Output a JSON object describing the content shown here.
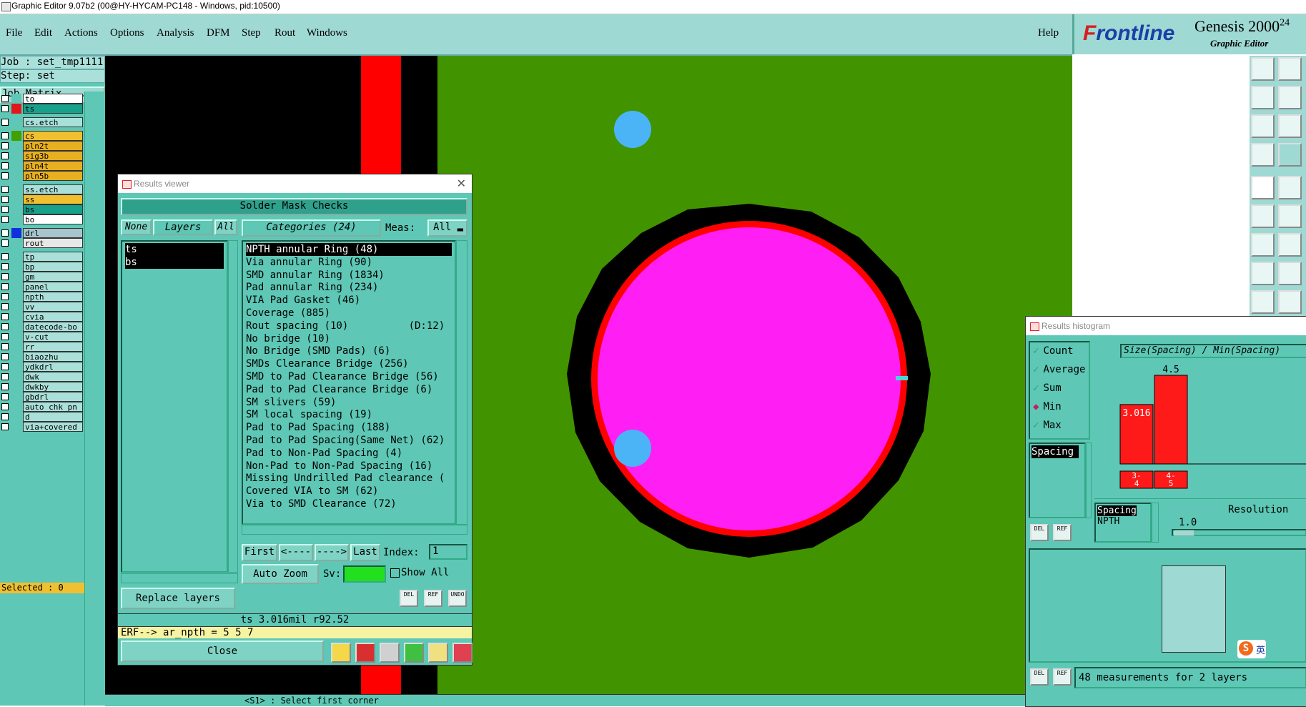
{
  "window": {
    "title": "Graphic Editor 9.07b2 (00@HY-HYCAM-PC148 - Windows, pid:10500)"
  },
  "menu": [
    "File",
    "Edit",
    "Actions",
    "Options",
    "Analysis",
    "DFM",
    "Step",
    "Rout",
    "Windows"
  ],
  "help_label": "Help",
  "logo": {
    "brand_f": "F",
    "brand_rest": "rontline",
    "product": "Genesis 2000",
    "version_fragment": "24",
    "subtitle": "Graphic Editor"
  },
  "job_panel": {
    "job": "Job : set_tmp1111",
    "step": "Step: set",
    "job_matrix_button": "Job Matrix ...",
    "selected": "Selected : 0"
  },
  "layers": [
    {
      "name": "to",
      "color": "#ffffff",
      "swatch": "#5ec7b5"
    },
    {
      "name": "ts",
      "color": "#17a08a",
      "swatch": "#e01818",
      "checked": true,
      "board": true
    },
    {
      "name": "cs.etch",
      "color": "#a9e0d9",
      "swatch": "#5ec7b5"
    },
    {
      "name": "cs",
      "color": "#f0c030",
      "swatch": "#41a000"
    },
    {
      "name": "pln2t",
      "color": "#e8b020",
      "swatch": "#5ec7b5"
    },
    {
      "name": "sig3b",
      "color": "#e8b020",
      "swatch": "#5ec7b5"
    },
    {
      "name": "pln4t",
      "color": "#e8b020",
      "swatch": "#5ec7b5"
    },
    {
      "name": "pln5b",
      "color": "#e8b020",
      "swatch": "#5ec7b5"
    },
    {
      "name": "ss.etch",
      "color": "#a9e0d9",
      "swatch": "#5ec7b5"
    },
    {
      "name": "ss",
      "color": "#f0c030",
      "swatch": "#5ec7b5"
    },
    {
      "name": "bs",
      "color": "#17a08a",
      "swatch": "#5ec7b5"
    },
    {
      "name": "bo",
      "color": "#ffffff",
      "swatch": "#5ec7b5"
    },
    {
      "name": "drl",
      "color": "#a8c4cc",
      "swatch": "#1030e0"
    },
    {
      "name": "rout",
      "color": "#e8e8e8",
      "swatch": "#5ec7b5"
    },
    {
      "name": "tp",
      "color": "#a9e0d9",
      "swatch": "#5ec7b5"
    },
    {
      "name": "bp",
      "color": "#a9e0d9",
      "swatch": "#5ec7b5"
    },
    {
      "name": "gm",
      "color": "#a9e0d9",
      "swatch": "#5ec7b5"
    },
    {
      "name": "panel",
      "color": "#a9e0d9",
      "swatch": "#5ec7b5"
    },
    {
      "name": "npth",
      "color": "#a9e0d9",
      "swatch": "#5ec7b5"
    },
    {
      "name": "vv",
      "color": "#a9e0d9",
      "swatch": "#5ec7b5"
    },
    {
      "name": "cvia",
      "color": "#a9e0d9",
      "swatch": "#5ec7b5"
    },
    {
      "name": "datecode-bo",
      "color": "#a9e0d9",
      "swatch": "#5ec7b5"
    },
    {
      "name": "v-cut",
      "color": "#a9e0d9",
      "swatch": "#5ec7b5"
    },
    {
      "name": "rr",
      "color": "#a9e0d9",
      "swatch": "#5ec7b5"
    },
    {
      "name": "biaozhu",
      "color": "#a9e0d9",
      "swatch": "#5ec7b5"
    },
    {
      "name": "ydkdrl",
      "color": "#a9e0d9",
      "swatch": "#5ec7b5"
    },
    {
      "name": "dwk",
      "color": "#a9e0d9",
      "swatch": "#5ec7b5"
    },
    {
      "name": "dwkby",
      "color": "#a9e0d9",
      "swatch": "#5ec7b5"
    },
    {
      "name": "gbdrl",
      "color": "#a9e0d9",
      "swatch": "#5ec7b5"
    },
    {
      "name": "auto_chk_pn",
      "color": "#a9e0d9",
      "swatch": "#5ec7b5"
    },
    {
      "name": "d",
      "color": "#a9e0d9",
      "swatch": "#5ec7b5"
    },
    {
      "name": "via+covered",
      "color": "#a9e0d9",
      "swatch": "#5ec7b5"
    }
  ],
  "results_viewer": {
    "title": "Results viewer",
    "heading": "Solder Mask Checks",
    "none_label": "None",
    "layers_label": "Layers",
    "all_label": "All",
    "layer_list": [
      "ts",
      "bs"
    ],
    "categories_label": "Categories (24)",
    "meas_label": "Meas:",
    "meas_value": "All",
    "categories": [
      "NPTH annular Ring (48)",
      "Via annular Ring (90)",
      "SMD annular Ring (1834)",
      "Pad annular Ring (234)",
      "VIA Pad Gasket (46)",
      "Coverage (885)",
      "Rout spacing (10)          (D:12)",
      "No bridge (10)",
      "No Bridge (SMD Pads) (6)",
      "SMDs Clearance Bridge (256)",
      "SMD to Pad Clearance Bridge (56)",
      "Pad to Pad Clearance Bridge (6)",
      "SM slivers (59)",
      "SM local spacing (19)",
      "Pad to Pad Spacing (188)",
      "Pad to Pad Spacing(Same Net) (62)",
      "Pad to Non-Pad Spacing (4)",
      "Non-Pad to Non-Pad Spacing (16)",
      "Missing Undrilled Pad clearance (",
      "Covered VIA to SM (62)",
      "Via to SMD Clearance (72)"
    ],
    "first_label": "First",
    "prev_label": "<----",
    "next_label": "---->",
    "last_label": "Last",
    "index_label": "Index:",
    "index_value": "1",
    "auto_zoom_label": "Auto Zoom",
    "sv_label": "Sv:",
    "show_all_label": "Show All",
    "replace_layers_label": "Replace layers",
    "del_label": "DEL",
    "ref_label": "REF",
    "undo_label": "UNDO",
    "status": "ts 3.016mil  r92.52",
    "erf": "ERF--> ar_npth = 5 5 7",
    "close_label": "Close"
  },
  "histogram": {
    "title": "Results histogram",
    "options": [
      "Count",
      "Average",
      "Sum",
      "Min",
      "Max"
    ],
    "selected_option": "Min",
    "header": "Size(Spacing) / Min(Spacing)",
    "list_item": "Spacing",
    "bars": [
      {
        "range": "3-4",
        "value": 3.016,
        "label": "3.016"
      },
      {
        "range": "4-5",
        "value": 4.5,
        "label": "4.5"
      }
    ],
    "legend_title": "Spacing",
    "legend_item": "NPTH",
    "resolution_label": "Resolution",
    "resolution_value": "1.0",
    "measurements": "48 measurements for 2 layers",
    "ime_char": "英"
  },
  "bottom": {
    "prompt": "<S1> : Select first corner"
  },
  "colors": {
    "board": "#419400",
    "pad": "#ff1ff5",
    "ring": "#ff0000",
    "mask": "#000000",
    "drill": "#4ab4f7"
  }
}
